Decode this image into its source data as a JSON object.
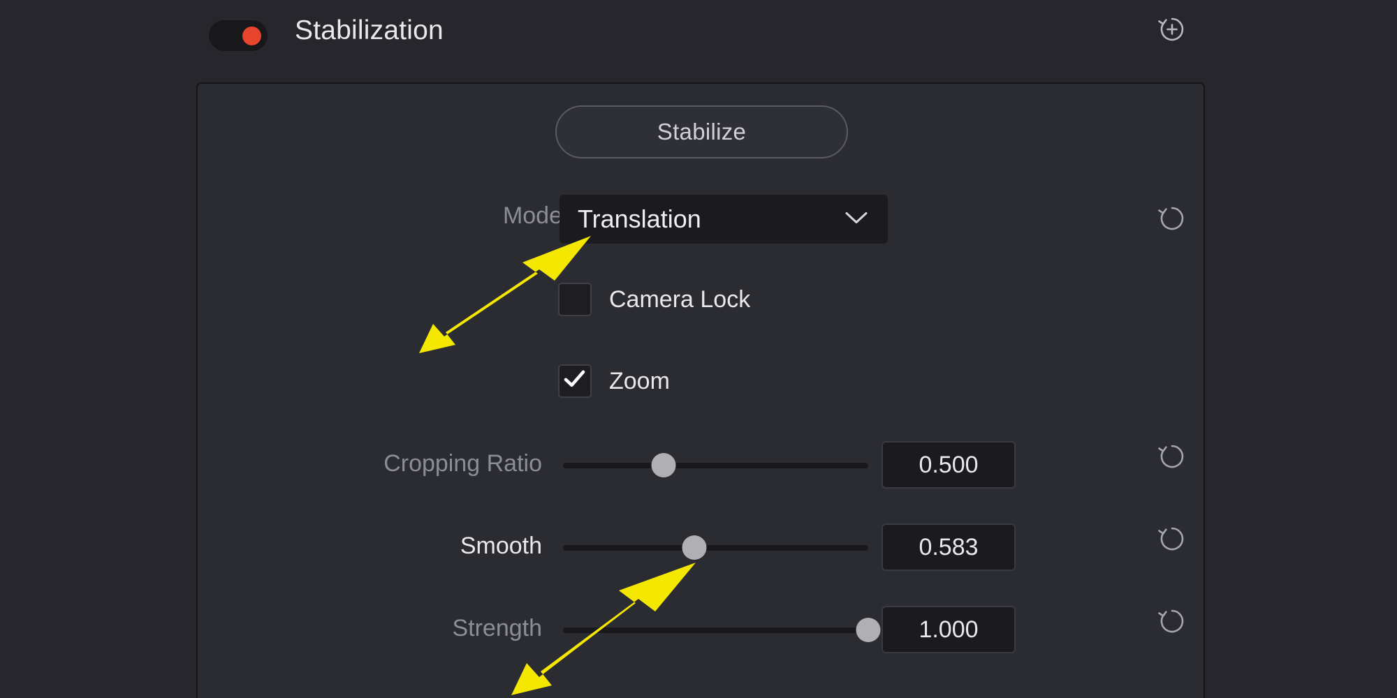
{
  "panel": {
    "title": "Stabilization",
    "enabled": true,
    "toggle_color": "#e8452e",
    "reset_all_icon": "reset-plus-icon"
  },
  "actions": {
    "stabilize_label": "Stabilize"
  },
  "mode": {
    "label": "Mode",
    "value": "Translation",
    "chevron_icon": "chevron-down-icon",
    "reset_icon": "reset-icon"
  },
  "checkboxes": [
    {
      "label": "Camera Lock",
      "checked": false
    },
    {
      "label": "Zoom",
      "checked": true
    }
  ],
  "sliders": [
    {
      "label": "Cropping Ratio",
      "value": "0.500",
      "fill_percent": 33,
      "dim_label": true,
      "reset_icon": "reset-icon"
    },
    {
      "label": "Smooth",
      "value": "0.583",
      "fill_percent": 43,
      "dim_label": false,
      "reset_icon": "reset-icon"
    },
    {
      "label": "Strength",
      "value": "1.000",
      "fill_percent": 100,
      "dim_label": true,
      "reset_icon": "reset-icon"
    }
  ],
  "annotations": {
    "color": "#f5e800",
    "arrows": [
      {
        "name": "arrow-to-mode-dropdown",
        "target": "Mode dropdown"
      },
      {
        "name": "arrow-to-smooth-slider",
        "target": "Smooth slider handle"
      }
    ]
  }
}
